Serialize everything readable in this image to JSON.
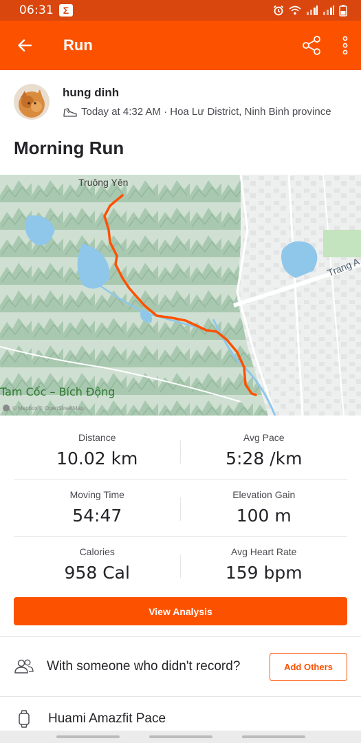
{
  "status_bar": {
    "time": "06:31",
    "app_badge": "Σ"
  },
  "app_bar": {
    "title": "Run",
    "icons": [
      "back-arrow-icon",
      "share-icon",
      "more-vertical-icon"
    ]
  },
  "athlete": {
    "name": "hung dinh",
    "timestamp_location": "Today at 4:32 AM · Hoa Lư District, Ninh Binh province"
  },
  "activity": {
    "title": "Morning Run"
  },
  "map": {
    "place_label": "Truông Yên",
    "poi_label": "Tam Cốc – Bích Động",
    "road_label": "Trang A",
    "attribution": "© Mapbox © OpenStreetMap"
  },
  "stats": [
    {
      "label": "Distance",
      "value": "10.02 km"
    },
    {
      "label": "Avg Pace",
      "value": "5:28 /km"
    },
    {
      "label": "Moving Time",
      "value": "54:47"
    },
    {
      "label": "Elevation Gain",
      "value": "100 m"
    },
    {
      "label": "Calories",
      "value": "958 Cal"
    },
    {
      "label": "Avg Heart Rate",
      "value": "159 bpm"
    }
  ],
  "actions": {
    "view_analysis": "View Analysis",
    "with_someone": "With someone who didn't record?",
    "add_others": "Add Others"
  },
  "device": {
    "name": "Huami Amazfit Pace"
  },
  "colors": {
    "brand": "#fc5200",
    "status_bar": "#d9470f",
    "route": "#fc5200"
  }
}
